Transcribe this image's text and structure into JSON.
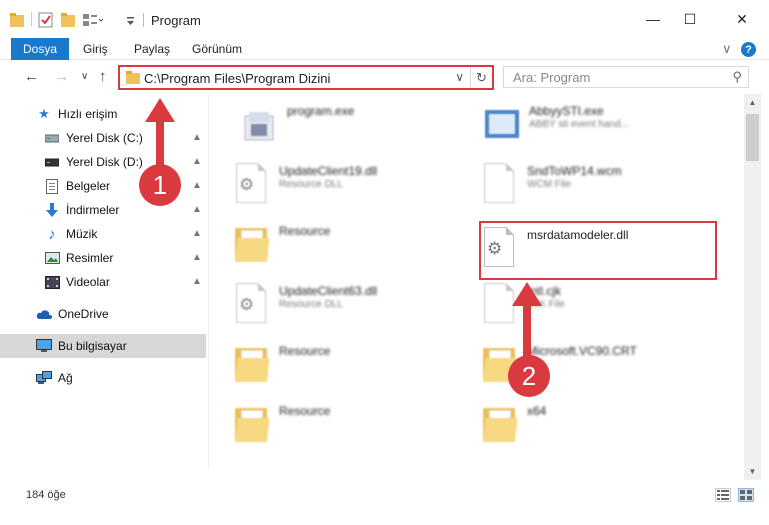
{
  "window": {
    "title": "Program",
    "minimize_glyph": "—",
    "maximize_glyph": "☐",
    "close_glyph": "✕"
  },
  "ribbon": {
    "tabs": [
      "Dosya",
      "Giriş",
      "Paylaş",
      "Görünüm"
    ],
    "collapse_glyph": "∨",
    "help_glyph": "?"
  },
  "nav": {
    "back_glyph": "←",
    "forward_glyph": "→",
    "recent_glyph": "∨",
    "up_glyph": "↑",
    "address": "C:\\Program Files\\Program Dizini",
    "dropdown_glyph": "∨",
    "refresh_glyph": "↻",
    "search_placeholder": "Ara: Program",
    "search_glyph": "⚲"
  },
  "sidebar": {
    "items": [
      {
        "label": "Hızlı erişim",
        "icon": "star-icon",
        "pinned": false
      },
      {
        "label": "Yerel Disk (C:)",
        "icon": "drive-icon",
        "pinned": true
      },
      {
        "label": "Yerel Disk (D:)",
        "icon": "drive-icon",
        "pinned": true
      },
      {
        "label": "Belgeler",
        "icon": "documents-icon",
        "pinned": true
      },
      {
        "label": "İndirmeler",
        "icon": "download-icon",
        "pinned": true
      },
      {
        "label": "Müzik",
        "icon": "music-icon",
        "pinned": true
      },
      {
        "label": "Resimler",
        "icon": "pictures-icon",
        "pinned": true
      },
      {
        "label": "Videolar",
        "icon": "videos-icon",
        "pinned": true
      },
      {
        "label": "OneDrive",
        "icon": "cloud-icon",
        "pinned": false
      },
      {
        "label": "Bu bilgisayar",
        "icon": "computer-icon",
        "pinned": false
      },
      {
        "label": "Ağ",
        "icon": "network-icon",
        "pinned": false
      }
    ],
    "pin_glyph": "📌"
  },
  "files": [
    {
      "name": "program.exe",
      "sub": "",
      "type": "exe",
      "blurred": true
    },
    {
      "name": "AbbyySTI.exe",
      "sub": "ABBY sti event hand...",
      "type": "exe",
      "blurred": true
    },
    {
      "name": "UpdateClient19.dll",
      "sub": "Resource DLL",
      "type": "dll",
      "blurred": true
    },
    {
      "name": "SndToWP14.wcm",
      "sub": "WCM File",
      "type": "file",
      "blurred": true
    },
    {
      "name": "Resource",
      "sub": "",
      "type": "folder",
      "blurred": true
    },
    {
      "name": "msrdatamodeler.dll",
      "sub": "",
      "type": "dll",
      "blurred": false
    },
    {
      "name": "UpdateClient63.dll",
      "sub": "Resource DLL",
      "type": "dll",
      "blurred": true
    },
    {
      "name": "Intl.cjk",
      "sub": "CJK File",
      "type": "file",
      "blurred": true
    },
    {
      "name": "Resource",
      "sub": "",
      "type": "folder",
      "blurred": true
    },
    {
      "name": "Microsoft.VC90.CRT",
      "sub": "",
      "type": "folder",
      "blurred": true
    },
    {
      "name": "Resource",
      "sub": "",
      "type": "folder",
      "blurred": true
    },
    {
      "name": "x64",
      "sub": "",
      "type": "folder",
      "blurred": true
    }
  ],
  "status": {
    "count": "184 öğe"
  },
  "annotations": {
    "step1": "1",
    "step2": "2",
    "color": "#d9393f"
  }
}
